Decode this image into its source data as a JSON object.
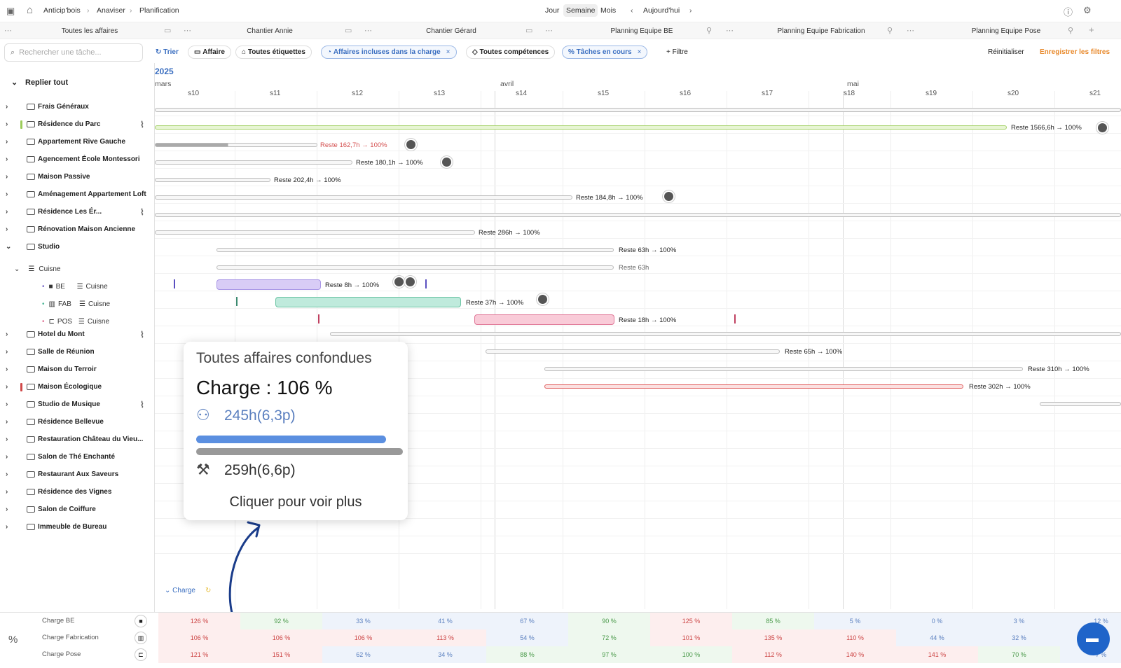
{
  "breadcrumb": {
    "app": "Anticip'bois",
    "section": "Anaviser",
    "page": "Planification"
  },
  "view_switch": {
    "day": "Jour",
    "week": "Semaine",
    "month": "Mois",
    "today": "Aujourd'hui"
  },
  "tabs": [
    "Toutes les affaires",
    "Chantier Annie",
    "Chantier Gérard",
    "Planning Equipe BE",
    "Planning Equipe Fabrication",
    "Planning Equipe Pose"
  ],
  "toolbar": {
    "search_placeholder": "Rechercher une tâche...",
    "sort": "Trier",
    "affaire": "Affaire",
    "labels": "Toutes étiquettes",
    "included": "Affaires incluses dans la charge",
    "skills": "Toutes compétences",
    "tasks": "Tâches en cours",
    "filter": "Filtre",
    "reset": "Réinitialiser",
    "save": "Enregistrer les filtres"
  },
  "collapse_all": "Replier tout",
  "year": "2025",
  "months": [
    "mars",
    "avril",
    "mai"
  ],
  "weeks": [
    "s10",
    "s11",
    "s12",
    "s13",
    "s14",
    "s15",
    "s16",
    "s17",
    "s18",
    "s19",
    "s20",
    "s21"
  ],
  "projects": [
    "Frais Généraux",
    "Résidence du Parc",
    "Appartement Rive Gauche",
    "Agencement École Montessori",
    "Maison Passive",
    "Aménagement Appartement Loft",
    "Résidence Les Ér...",
    "Rénovation Maison Ancienne",
    "Studio",
    "Hotel du Mont",
    "Salle de Réunion",
    "Maison du Terroir",
    "Maison Écologique",
    "Studio de Musique",
    "Résidence Bellevue",
    "Restauration Château du Vieu...",
    "Salon de Thé Enchanté",
    "Restaurant Aux Saveurs",
    "Résidence des Vignes",
    "Salon de Coiffure",
    "Immeuble de Bureau"
  ],
  "studio_children": {
    "group": "Cuisne",
    "tasks": [
      {
        "team": "BE",
        "skill": "Cuisne"
      },
      {
        "team": "FAB",
        "skill": "Cuisne"
      },
      {
        "team": "POS",
        "skill": "Cuisne"
      }
    ]
  },
  "remaining_labels": [
    "Reste 1566,6h → 100%",
    "Reste 162,7h → 100%",
    "Reste 180,1h → 100%",
    "Reste 202,4h → 100%",
    "Reste 184,8h → 100%",
    "Reste 286h → 100%",
    "Reste 63h → 100%",
    "Reste 63h",
    "Reste 8h → 100%",
    "Reste 37h → 100%",
    "Reste 18h → 100%",
    "Reste 65h → 100%",
    "Reste 310h → 100%",
    "Reste 302h → 100%"
  ],
  "tooltip": {
    "title": "Toutes affaires confondues",
    "charge": "Charge : 106 %",
    "capacity": "245h(6,3p)",
    "capacity_fill": 0.95,
    "load": "259h(6,6p)",
    "cta": "Cliquer pour voir plus"
  },
  "charge": {
    "toggle": "Charge",
    "rows": [
      {
        "label": "Charge BE",
        "values": [
          "126 %",
          "92 %",
          "33 %",
          "41 %",
          "67 %",
          "90 %",
          "125 %",
          "85 %",
          "5 %",
          "0 %",
          "3 %",
          "12 %"
        ]
      },
      {
        "label": "Charge Fabrication",
        "values": [
          "106 %",
          "106 %",
          "106 %",
          "113 %",
          "54 %",
          "72 %",
          "101 %",
          "135 %",
          "110 %",
          "44 %",
          "32 %",
          "7 %"
        ]
      },
      {
        "label": "Charge Pose",
        "values": [
          "121 %",
          "151 %",
          "62 %",
          "34 %",
          "88 %",
          "97 %",
          "100 %",
          "112 %",
          "140 %",
          "141 %",
          "70 %",
          "7 %"
        ]
      }
    ]
  },
  "colors": {
    "accent": "#3a6ec0",
    "orange": "#e8892b",
    "purple": "#c9b8f0",
    "green": "#a9e0cf",
    "pink": "#f4b7c8",
    "red": "#e06060",
    "chat": "#1f64c9"
  }
}
